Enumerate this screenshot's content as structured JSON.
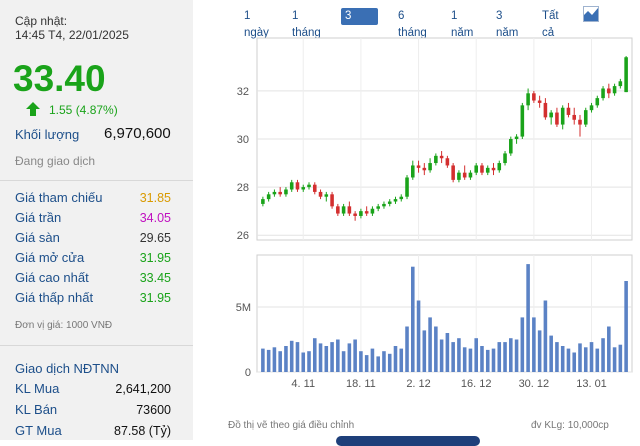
{
  "update": {
    "label": "Cập nhật:",
    "time": "14:45 T4, 22/01/2025"
  },
  "price": "33.40",
  "change": "1.55 (4.87%)",
  "volume": {
    "label": "Khối lượng",
    "value": "6,970,600"
  },
  "status": "Đang giao dịch",
  "stats": [
    {
      "label": "Giá tham chiếu",
      "value": "31.85",
      "color": "#d99a00"
    },
    {
      "label": "Giá trần",
      "value": "34.05",
      "color": "#c010c0"
    },
    {
      "label": "Giá sàn",
      "value": "29.65",
      "color": "#333333"
    },
    {
      "label": "Giá mở cửa",
      "value": "31.95",
      "color": "#1aa31a"
    },
    {
      "label": "Giá cao nhất",
      "value": "33.45",
      "color": "#1aa31a"
    },
    {
      "label": "Giá thấp nhất",
      "value": "31.95",
      "color": "#1aa31a"
    }
  ],
  "unit_note": "Đơn vị giá: 1000 VNĐ",
  "foreign": {
    "title": "Giao dịch NĐTNN",
    "rows": [
      {
        "label": "KL Mua",
        "value": "2,641,200"
      },
      {
        "label": "KL Bán",
        "value": "73600"
      },
      {
        "label": "GT Mua",
        "value": "87.58 (Tỷ)"
      }
    ]
  },
  "tabs": [
    "1 ngày",
    "1 tháng",
    "3 tháng",
    "6 tháng",
    "1 năm",
    "3 năm",
    "Tất cả"
  ],
  "active_tab": 2,
  "chart_icon": "area-chart-icon",
  "footer": {
    "left": "Đồ thị vẽ theo giá điều chỉnh",
    "right": "đv KLg: 10,000cp"
  },
  "colors": {
    "up": "#1aa31a",
    "down": "#d32f2f",
    "volume": "#5b82c5",
    "brand": "#1d4f8a"
  },
  "chart_data": {
    "type": "candlestick",
    "price_axis": {
      "ticks": [
        26,
        28,
        30,
        32
      ],
      "ylim": [
        25.8,
        34.2
      ]
    },
    "volume_axis": {
      "ticks": [
        "0",
        "5M"
      ],
      "ylim_millions": [
        0,
        9
      ]
    },
    "x_ticks": [
      "4. 11",
      "18. 11",
      "2. 12",
      "16. 12",
      "30. 12",
      "13. 01"
    ],
    "candles": [
      [
        27.3,
        27.6,
        27.5,
        27.2
      ],
      [
        27.5,
        27.8,
        27.7,
        27.4
      ],
      [
        27.7,
        27.9,
        27.8,
        27.6
      ],
      [
        27.8,
        28.0,
        27.7,
        27.6
      ],
      [
        27.7,
        28.0,
        27.9,
        27.6
      ],
      [
        27.9,
        28.3,
        28.2,
        27.8
      ],
      [
        28.2,
        28.3,
        27.9,
        27.8
      ],
      [
        27.9,
        28.1,
        28.0,
        27.8
      ],
      [
        28.0,
        28.2,
        28.1,
        27.9
      ],
      [
        28.1,
        28.2,
        27.8,
        27.7
      ],
      [
        27.8,
        27.9,
        27.6,
        27.5
      ],
      [
        27.6,
        27.8,
        27.7,
        27.4
      ],
      [
        27.7,
        27.8,
        27.2,
        27.1
      ],
      [
        27.2,
        27.3,
        26.9,
        26.8
      ],
      [
        26.9,
        27.3,
        27.2,
        26.8
      ],
      [
        27.2,
        27.4,
        26.9,
        26.8
      ],
      [
        26.9,
        27.0,
        26.8,
        26.6
      ],
      [
        26.8,
        27.1,
        27.0,
        26.7
      ],
      [
        27.0,
        27.2,
        26.9,
        26.8
      ],
      [
        26.9,
        27.2,
        27.1,
        26.8
      ],
      [
        27.1,
        27.3,
        27.2,
        27.0
      ],
      [
        27.2,
        27.4,
        27.3,
        27.1
      ],
      [
        27.3,
        27.5,
        27.4,
        27.2
      ],
      [
        27.4,
        27.6,
        27.5,
        27.3
      ],
      [
        27.5,
        27.7,
        27.6,
        27.4
      ],
      [
        27.6,
        28.5,
        28.4,
        27.5
      ],
      [
        28.4,
        29.1,
        28.9,
        28.3
      ],
      [
        28.9,
        29.1,
        28.8,
        28.6
      ],
      [
        28.8,
        29.0,
        28.7,
        28.5
      ],
      [
        28.7,
        29.2,
        29.0,
        28.6
      ],
      [
        29.0,
        29.4,
        29.3,
        28.9
      ],
      [
        29.3,
        29.5,
        29.2,
        29.0
      ],
      [
        29.2,
        29.3,
        28.9,
        28.8
      ],
      [
        28.9,
        29.0,
        28.3,
        28.2
      ],
      [
        28.3,
        28.7,
        28.6,
        28.2
      ],
      [
        28.6,
        28.9,
        28.4,
        28.3
      ],
      [
        28.4,
        28.7,
        28.6,
        28.3
      ],
      [
        28.6,
        29.0,
        28.9,
        28.5
      ],
      [
        28.9,
        29.0,
        28.6,
        28.5
      ],
      [
        28.6,
        28.9,
        28.8,
        28.5
      ],
      [
        28.8,
        29.0,
        28.7,
        28.5
      ],
      [
        28.7,
        29.1,
        29.0,
        28.6
      ],
      [
        29.0,
        29.5,
        29.4,
        28.9
      ],
      [
        29.4,
        30.1,
        30.0,
        29.3
      ],
      [
        30.0,
        30.2,
        30.1,
        29.8
      ],
      [
        30.1,
        31.5,
        31.4,
        30.0
      ],
      [
        31.4,
        32.1,
        31.9,
        31.2
      ],
      [
        31.9,
        32.0,
        31.6,
        31.5
      ],
      [
        31.6,
        31.8,
        31.5,
        31.3
      ],
      [
        31.5,
        31.7,
        30.9,
        30.8
      ],
      [
        30.9,
        31.2,
        31.1,
        30.6
      ],
      [
        31.1,
        31.3,
        30.6,
        30.5
      ],
      [
        30.6,
        31.4,
        31.3,
        30.4
      ],
      [
        31.3,
        31.5,
        31.0,
        30.9
      ],
      [
        31.0,
        31.3,
        30.8,
        30.6
      ],
      [
        30.8,
        31.0,
        30.6,
        30.1
      ],
      [
        30.6,
        31.3,
        31.2,
        30.5
      ],
      [
        31.2,
        31.5,
        31.4,
        31.1
      ],
      [
        31.4,
        31.8,
        31.7,
        31.3
      ],
      [
        31.7,
        32.2,
        32.1,
        31.6
      ],
      [
        32.1,
        32.3,
        31.9,
        31.7
      ],
      [
        31.9,
        32.3,
        32.2,
        31.8
      ],
      [
        32.2,
        32.5,
        32.4,
        32.1
      ],
      [
        31.95,
        33.45,
        33.4,
        31.95
      ]
    ],
    "volumes_millions": [
      1.8,
      1.7,
      1.9,
      1.6,
      2.0,
      2.4,
      2.3,
      1.5,
      1.6,
      2.6,
      2.2,
      2.0,
      2.3,
      2.5,
      1.6,
      2.2,
      2.5,
      1.6,
      1.3,
      1.8,
      1.2,
      1.6,
      1.4,
      2.0,
      1.8,
      3.5,
      8.1,
      5.5,
      3.2,
      4.2,
      3.5,
      2.5,
      3.0,
      2.3,
      2.6,
      1.9,
      1.8,
      2.6,
      2.0,
      1.7,
      1.8,
      2.3,
      2.3,
      2.6,
      2.5,
      4.2,
      8.3,
      4.2,
      3.2,
      5.5,
      2.8,
      2.3,
      2.0,
      1.8,
      1.5,
      2.2,
      1.9,
      2.3,
      1.8,
      2.6,
      3.5,
      1.9,
      2.1,
      7.0
    ]
  }
}
